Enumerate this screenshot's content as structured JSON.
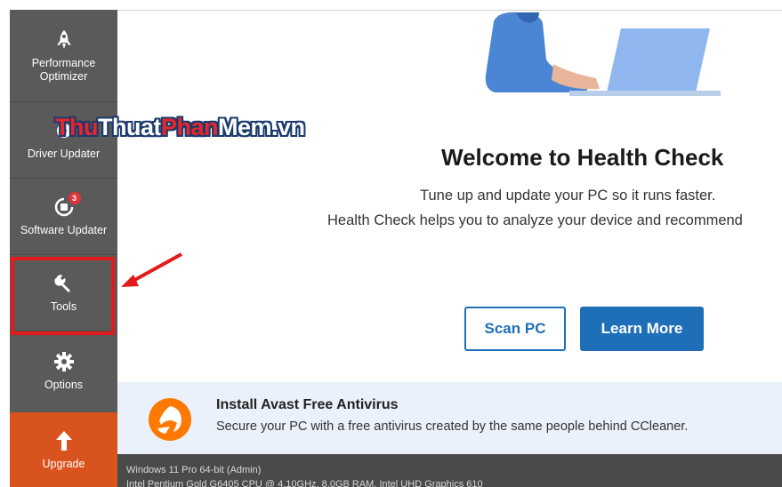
{
  "sidebar": {
    "items": [
      {
        "label_1": "Performance",
        "label_2": "Optimizer",
        "icon": "rocket-icon"
      },
      {
        "label": "Driver Updater",
        "icon": "gear-chip-icon"
      },
      {
        "label": "Software Updater",
        "icon": "refresh-icon",
        "badge": "3"
      },
      {
        "label": "Tools",
        "icon": "wrench-icon"
      },
      {
        "label": "Options",
        "icon": "gear-icon"
      }
    ],
    "upgrade_label": "Upgrade",
    "upgrade_icon": "arrow-up-icon"
  },
  "main": {
    "title": "Welcome to Health Check",
    "subtitle_1": "Tune up and update your PC so it runs faster.",
    "subtitle_2": "Health Check helps you to analyze your device and recommend",
    "scan_button": "Scan PC",
    "learn_button": "Learn More"
  },
  "banner": {
    "title": "Install Avast Free Antivirus",
    "text": "Secure your PC with a free antivirus created by the same people behind CCleaner."
  },
  "status": {
    "line_1": "Windows 11 Pro 64-bit (Admin)",
    "line_2": "Intel Pentium Gold G6405 CPU @ 4.10GHz, 8.0GB RAM, Intel UHD Graphics 610"
  },
  "watermark": {
    "part_1": "Thu",
    "part_2": "Thuat",
    "part_3": "Phan",
    "part_4": "Mem",
    "part_5": ".vn"
  },
  "colors": {
    "sidebar": "#5a5a5a",
    "upgrade": "#d9531e",
    "primary": "#1f6fb8",
    "highlight": "#e11b1b",
    "banner": "#eaf1fb"
  }
}
